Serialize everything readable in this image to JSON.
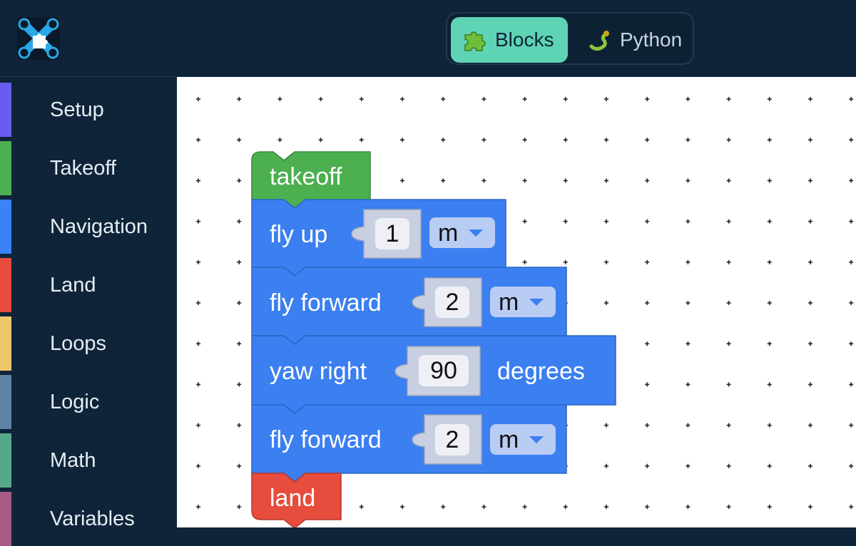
{
  "header": {
    "logo_icon": "drone-puzzle-logo-icon",
    "mode_toggle": {
      "blocks_label": "Blocks",
      "blocks_icon": "puzzle-piece-icon",
      "python_label": "Python",
      "python_icon": "python-snake-icon",
      "active": "Blocks",
      "active_color": "#5ed4b4"
    }
  },
  "sidebar": {
    "categories": [
      {
        "label": "Setup",
        "color": "#6a5cf0"
      },
      {
        "label": "Takeoff",
        "color": "#4caf50"
      },
      {
        "label": "Navigation",
        "color": "#3b82f6"
      },
      {
        "label": "Land",
        "color": "#e74c3c"
      },
      {
        "label": "Loops",
        "color": "#eec76a"
      },
      {
        "label": "Logic",
        "color": "#5f82a8"
      },
      {
        "label": "Math",
        "color": "#56a88a"
      },
      {
        "label": "Variables",
        "color": "#a85a86"
      }
    ]
  },
  "workspace": {
    "blocks": {
      "takeoff": {
        "label": "takeoff",
        "color": "#4caf50"
      },
      "fly_up": {
        "label": "fly up",
        "value": "1",
        "unit": "m",
        "color": "#3b7ff0"
      },
      "fly_forward_1": {
        "label": "fly forward",
        "value": "2",
        "unit": "m",
        "color": "#3b7ff0"
      },
      "yaw_right": {
        "label": "yaw right",
        "value": "90",
        "suffix": "degrees",
        "color": "#3b7ff0"
      },
      "fly_forward_2": {
        "label": "fly forward",
        "value": "2",
        "unit": "m",
        "color": "#3b7ff0"
      },
      "land": {
        "label": "land",
        "color": "#e74c3c"
      }
    }
  }
}
